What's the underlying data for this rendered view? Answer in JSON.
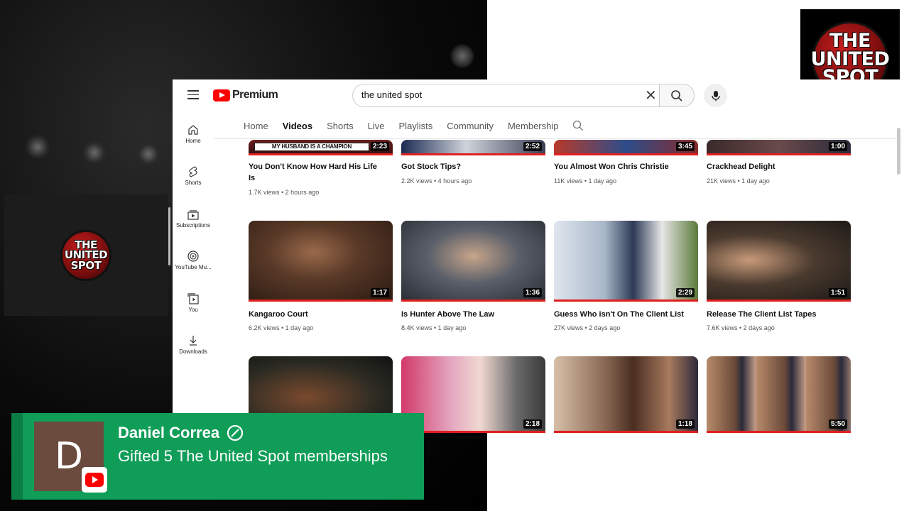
{
  "logo": {
    "line1": "THE",
    "line2": "UNITED",
    "line3": "SPOT"
  },
  "youtube": {
    "brand": "Premium",
    "search": {
      "value": "the united spot"
    },
    "sidebar": [
      {
        "label": "Home",
        "icon": "home-icon"
      },
      {
        "label": "Shorts",
        "icon": "shorts-icon"
      },
      {
        "label": "Subscriptions",
        "icon": "subscriptions-icon"
      },
      {
        "label": "YouTube Mu...",
        "icon": "youtube-music-icon"
      },
      {
        "label": "You",
        "icon": "you-icon"
      },
      {
        "label": "Downloads",
        "icon": "download-icon"
      }
    ],
    "tabs": [
      "Home",
      "Videos",
      "Shorts",
      "Live",
      "Playlists",
      "Community",
      "Membership"
    ],
    "active_tab": "Videos",
    "videos": [
      {
        "title": "You Don't Know How Hard His Life Is",
        "meta": "1.7K views • 2 hours ago",
        "duration": "2:23",
        "banner": "MY HUSBAND IS A CHAMPION"
      },
      {
        "title": "Got Stock Tips?",
        "meta": "2.2K views • 4 hours ago",
        "duration": "2:52"
      },
      {
        "title": "You Almost Won Chris Christie",
        "meta": "11K views • 1 day ago",
        "duration": "3:45"
      },
      {
        "title": "Crackhead Delight",
        "meta": "21K views • 1 day ago",
        "duration": "1:00"
      },
      {
        "title": "Kangaroo Court",
        "meta": "6.2K views • 1 day ago",
        "duration": "1:17"
      },
      {
        "title": "Is Hunter Above The Law",
        "meta": "8.4K views • 1 day ago",
        "duration": "1:36"
      },
      {
        "title": "Guess Who isn't On The Client List",
        "meta": "27K views • 2 days ago",
        "duration": "2:29"
      },
      {
        "title": "Release The Client List Tapes",
        "meta": "7.6K views • 2 days ago",
        "duration": "1:51"
      },
      {
        "duration": ""
      },
      {
        "duration": "2:18"
      },
      {
        "duration": "1:18"
      },
      {
        "duration": "5:50"
      }
    ]
  },
  "gift": {
    "avatar_letter": "D",
    "name": "Daniel Correa",
    "message": "Gifted 5 The United Spot memberships"
  },
  "colors": {
    "youtube_red": "#ff0000",
    "gift_green": "#0f9d58",
    "avatar_brown": "#6b4b3e"
  }
}
